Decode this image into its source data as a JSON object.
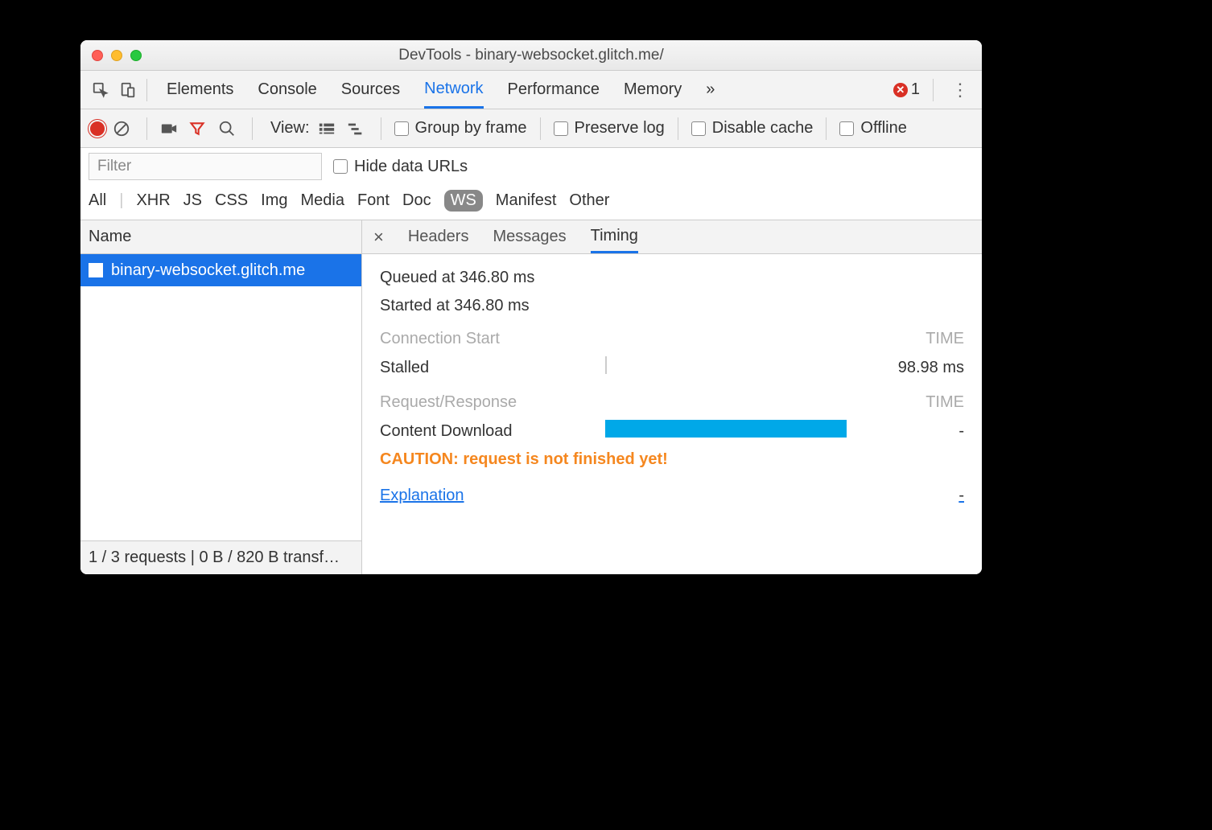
{
  "window": {
    "title": "DevTools - binary-websocket.glitch.me/"
  },
  "mainTabs": {
    "items": [
      "Elements",
      "Console",
      "Sources",
      "Network",
      "Performance",
      "Memory"
    ],
    "active": "Network",
    "overflow": "»",
    "errorCount": "1"
  },
  "toolbar": {
    "viewLabel": "View:",
    "groupByFrame": "Group by frame",
    "preserveLog": "Preserve log",
    "disableCache": "Disable cache",
    "offline": "Offline"
  },
  "filter": {
    "placeholder": "Filter",
    "hideDataUrls": "Hide data URLs",
    "types": [
      "All",
      "XHR",
      "JS",
      "CSS",
      "Img",
      "Media",
      "Font",
      "Doc",
      "WS",
      "Manifest",
      "Other"
    ],
    "activeType": "WS"
  },
  "leftCol": {
    "header": "Name",
    "requests": [
      {
        "name": "binary-websocket.glitch.me"
      }
    ],
    "footer": "1 / 3 requests | 0 B / 820 B transf…"
  },
  "detailTabs": {
    "items": [
      "Headers",
      "Messages",
      "Timing"
    ],
    "active": "Timing"
  },
  "timing": {
    "queued": "Queued at 346.80 ms",
    "started": "Started at 346.80 ms",
    "connHeader": "Connection Start",
    "timeHeader": "TIME",
    "stalledLabel": "Stalled",
    "stalledValue": "98.98 ms",
    "reqHeader": "Request/Response",
    "contentDownload": "Content Download",
    "contentDownloadValue": "-",
    "caution": "CAUTION: request is not finished yet!",
    "explanation": "Explanation",
    "explanationValue": "-"
  }
}
